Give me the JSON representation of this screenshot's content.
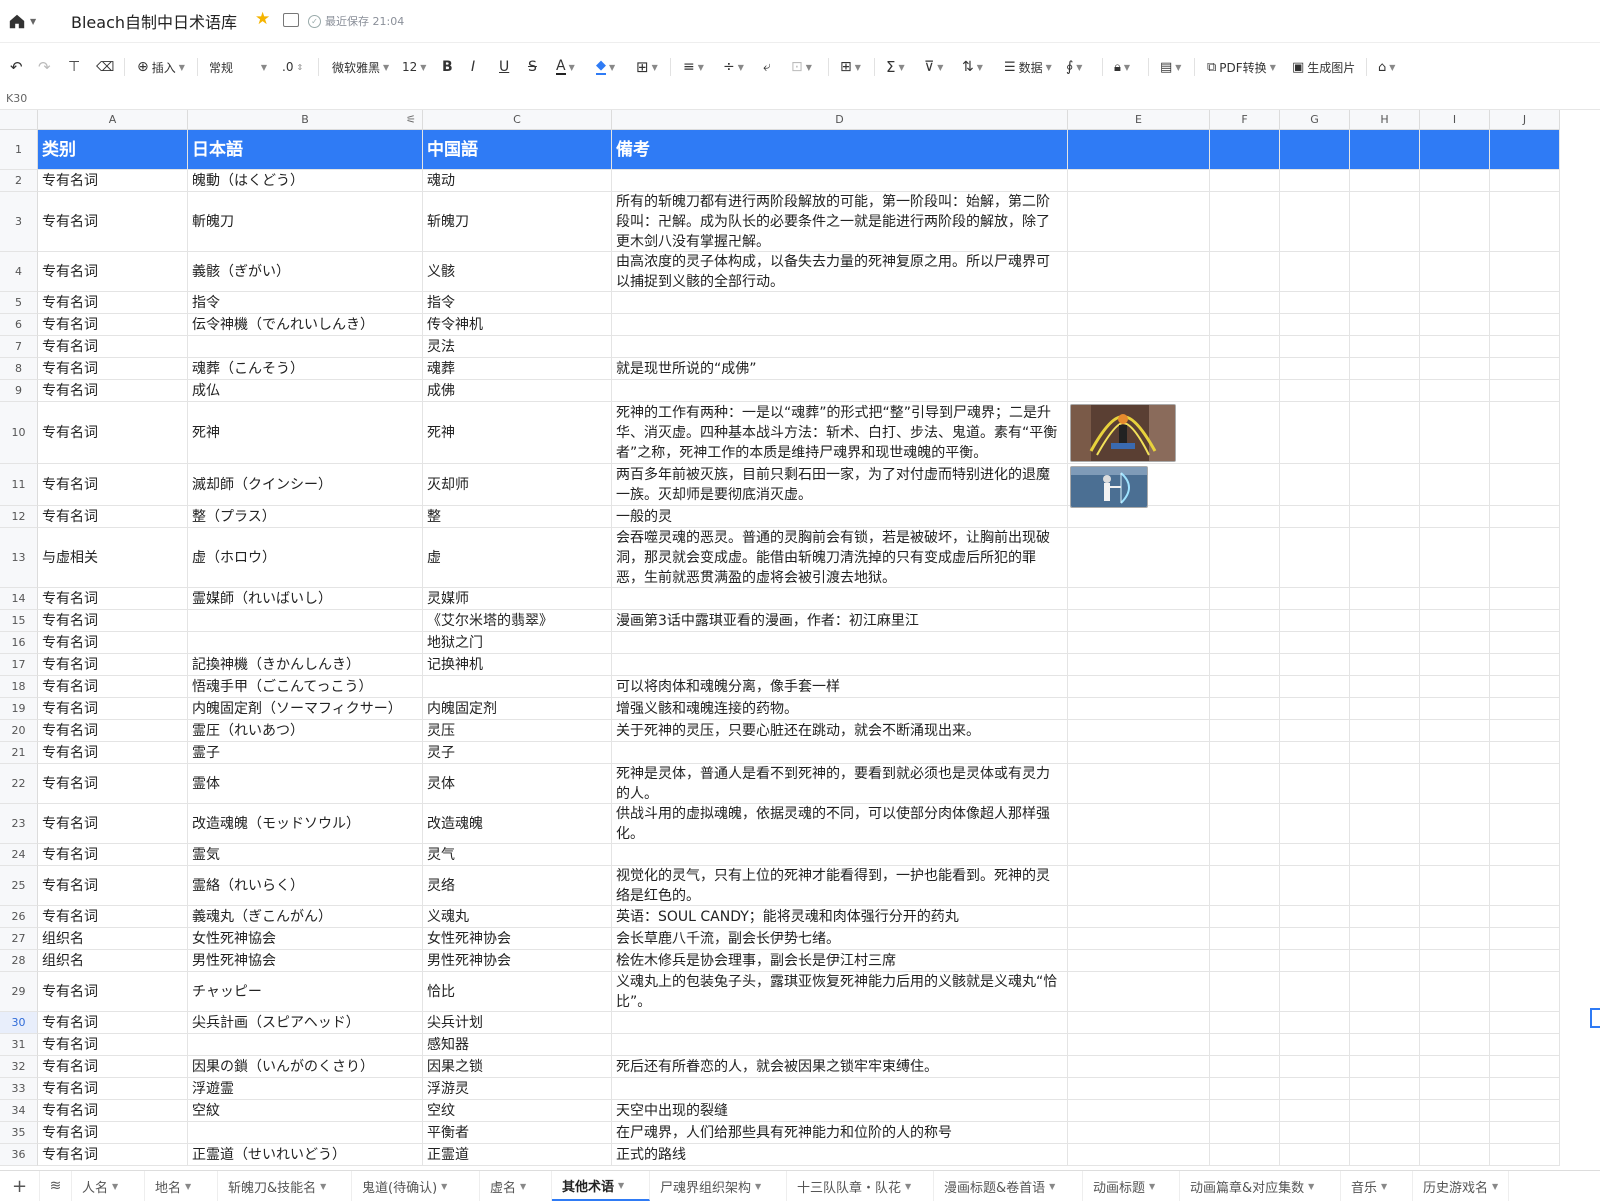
{
  "app": {
    "title": "Bleach自制中日术语库",
    "save_status": "最近保存 21:04"
  },
  "toolbar": {
    "insert": "插入",
    "format": "常规",
    "decimal": ".0",
    "font": "微软雅黑",
    "font_size": "12",
    "data": "数据",
    "pdf": "PDF转换",
    "image": "生成图片"
  },
  "cell_ref": "K30",
  "columns": [
    "A",
    "B",
    "C",
    "D",
    "E",
    "F",
    "G",
    "H",
    "I",
    "J"
  ],
  "header": {
    "a": "类别",
    "b": "日本語",
    "c": "中国語",
    "d": "備考"
  },
  "rows": [
    {
      "n": "2",
      "a": "专有名词",
      "b": "魄動（はくどう）",
      "c": "魂动",
      "d": ""
    },
    {
      "n": "3",
      "a": "专有名词",
      "b": "斬魄刀",
      "c": "斩魄刀",
      "d": "所有的斩魄刀都有进行两阶段解放的可能，第一阶段叫：始解，第二阶段叫：卍解。成为队长的必要条件之一就是能进行两阶段的解放，除了更木剑八没有掌握卍解。"
    },
    {
      "n": "4",
      "a": "专有名词",
      "b": "義骸（ぎがい）",
      "c": "义骸",
      "d": "由高浓度的灵子体构成，以备失去力量的死神复原之用。所以尸魂界可以捕捉到义骸的全部行动。"
    },
    {
      "n": "5",
      "a": "专有名词",
      "b": "指令",
      "c": "指令",
      "d": ""
    },
    {
      "n": "6",
      "a": "专有名词",
      "b": "伝令神機（でんれいしんき）",
      "c": "传令神机",
      "d": ""
    },
    {
      "n": "7",
      "a": "专有名词",
      "b": "",
      "c": "灵法",
      "d": ""
    },
    {
      "n": "8",
      "a": "专有名词",
      "b": "魂葬（こんそう）",
      "c": "魂葬",
      "d": "就是现世所说的“成佛”"
    },
    {
      "n": "9",
      "a": "专有名词",
      "b": "成仏",
      "c": "成佛",
      "d": ""
    },
    {
      "n": "10",
      "a": "专有名词",
      "b": "死神",
      "c": "死神",
      "d": "死神的工作有两种：一是以“魂葬”的形式把“整”引导到尸魂界；二是升华、消灭虚。四种基本战斗方法：斩术、白打、步法、鬼道。素有“平衡者”之称，死神工作的本质是维持尸魂界和现世魂魄的平衡。"
    },
    {
      "n": "11",
      "a": "专有名词",
      "b": "滅却師（クインシー）",
      "c": "灭却师",
      "d": "两百多年前被灭族，目前只剩石田一家，为了对付虚而特别进化的退魔一族。灭却师是要彻底消灭虚。"
    },
    {
      "n": "12",
      "a": "专有名词",
      "b": "整（プラス）",
      "c": "整",
      "d": "一般的灵"
    },
    {
      "n": "13",
      "a": "与虚相关",
      "b": "虚（ホロウ）",
      "c": "虚",
      "d": "会吞噬灵魂的恶灵。普通的灵胸前会有锁，若是被破坏，让胸前出现破洞，那灵就会变成虚。能借由斩魄刀清洗掉的只有变成虚后所犯的罪恶，生前就恶贯满盈的虚将会被引渡去地狱。"
    },
    {
      "n": "14",
      "a": "专有名词",
      "b": "霊媒師（れいばいし）",
      "c": "灵媒师",
      "d": ""
    },
    {
      "n": "15",
      "a": "专有名词",
      "b": "",
      "c": "《艾尔米塔的翡翠》",
      "d": "漫画第3话中露琪亚看的漫画，作者：初江麻里江"
    },
    {
      "n": "16",
      "a": "专有名词",
      "b": "",
      "c": "地狱之门",
      "d": ""
    },
    {
      "n": "17",
      "a": "专有名词",
      "b": "記換神機（きかんしんき）",
      "c": "记换神机",
      "d": ""
    },
    {
      "n": "18",
      "a": "专有名词",
      "b": "悟魂手甲（ごこんてっこう）",
      "c": "",
      "d": "可以将肉体和魂魄分离，像手套一样"
    },
    {
      "n": "19",
      "a": "专有名词",
      "b": "内魄固定剤（ソーマフィクサー）",
      "c": "内魄固定剂",
      "d": "增强义骸和魂魄连接的药物。"
    },
    {
      "n": "20",
      "a": "专有名词",
      "b": "霊圧（れいあつ）",
      "c": "灵压",
      "d": "关于死神的灵压，只要心脏还在跳动，就会不断涌现出来。"
    },
    {
      "n": "21",
      "a": "专有名词",
      "b": "霊子",
      "c": "灵子",
      "d": ""
    },
    {
      "n": "22",
      "a": "专有名词",
      "b": "霊体",
      "c": "灵体",
      "d": "死神是灵体，普通人是看不到死神的，要看到就必须也是灵体或有灵力的人。"
    },
    {
      "n": "23",
      "a": "专有名词",
      "b": "改造魂魄（モッドソウル）",
      "c": "改造魂魄",
      "d": "供战斗用的虚拟魂魄，依据灵魂的不同，可以使部分肉体像超人那样强化。"
    },
    {
      "n": "24",
      "a": "专有名词",
      "b": "霊気",
      "c": "灵气",
      "d": ""
    },
    {
      "n": "25",
      "a": "专有名词",
      "b": "霊絡（れいらく）",
      "c": "灵络",
      "d": "视觉化的灵气，只有上位的死神才能看得到，一护也能看到。死神的灵络是红色的。"
    },
    {
      "n": "26",
      "a": "专有名词",
      "b": "義魂丸（ぎこんがん）",
      "c": "义魂丸",
      "d": "英语：SOUL CANDY；能将灵魂和肉体强行分开的药丸"
    },
    {
      "n": "27",
      "a": "组织名",
      "b": "女性死神協会",
      "c": "女性死神协会",
      "d": "会长草鹿八千流，副会长伊势七绪。"
    },
    {
      "n": "28",
      "a": "组织名",
      "b": "男性死神協会",
      "c": "男性死神协会",
      "d": "桧佐木修兵是协会理事，副会长是伊江村三席"
    },
    {
      "n": "29",
      "a": "专有名词",
      "b": "チャッピー",
      "c": "恰比",
      "d": "义魂丸上的包装兔子头，露琪亚恢复死神能力后用的义骸就是义魂丸“恰比”。"
    },
    {
      "n": "30",
      "a": "专有名词",
      "b": "尖兵計画（スピアヘッド）",
      "c": "尖兵计划",
      "d": ""
    },
    {
      "n": "31",
      "a": "专有名词",
      "b": "",
      "c": "感知器",
      "d": ""
    },
    {
      "n": "32",
      "a": "专有名词",
      "b": "因果の鎖（いんがのくさり）",
      "c": "因果之锁",
      "d": "死后还有所眷恋的人，就会被因果之锁牢牢束缚住。"
    },
    {
      "n": "33",
      "a": "专有名词",
      "b": "浮遊霊",
      "c": "浮游灵",
      "d": ""
    },
    {
      "n": "34",
      "a": "专有名词",
      "b": "空紋",
      "c": "空纹",
      "d": "天空中出现的裂缝"
    },
    {
      "n": "35",
      "a": "专有名词",
      "b": "",
      "c": "平衡者",
      "d": "在尸魂界，人们给那些具有死神能力和位阶的人的称号"
    },
    {
      "n": "36",
      "a": "专有名词",
      "b": "正霊道（せいれいどう）",
      "c": "正霊道",
      "d": "正式的路线"
    }
  ],
  "sheets": [
    "人名",
    "地名",
    "斩魄刀&技能名",
    "鬼道(待确认)",
    "虚名",
    "其他术语",
    "尸魂界组织架构",
    "十三队队章・队花",
    "漫画标题&卷首语",
    "动画标题",
    "动画篇章&对应集数",
    "音乐",
    "历史游戏名"
  ],
  "active_sheet": "其他术语"
}
